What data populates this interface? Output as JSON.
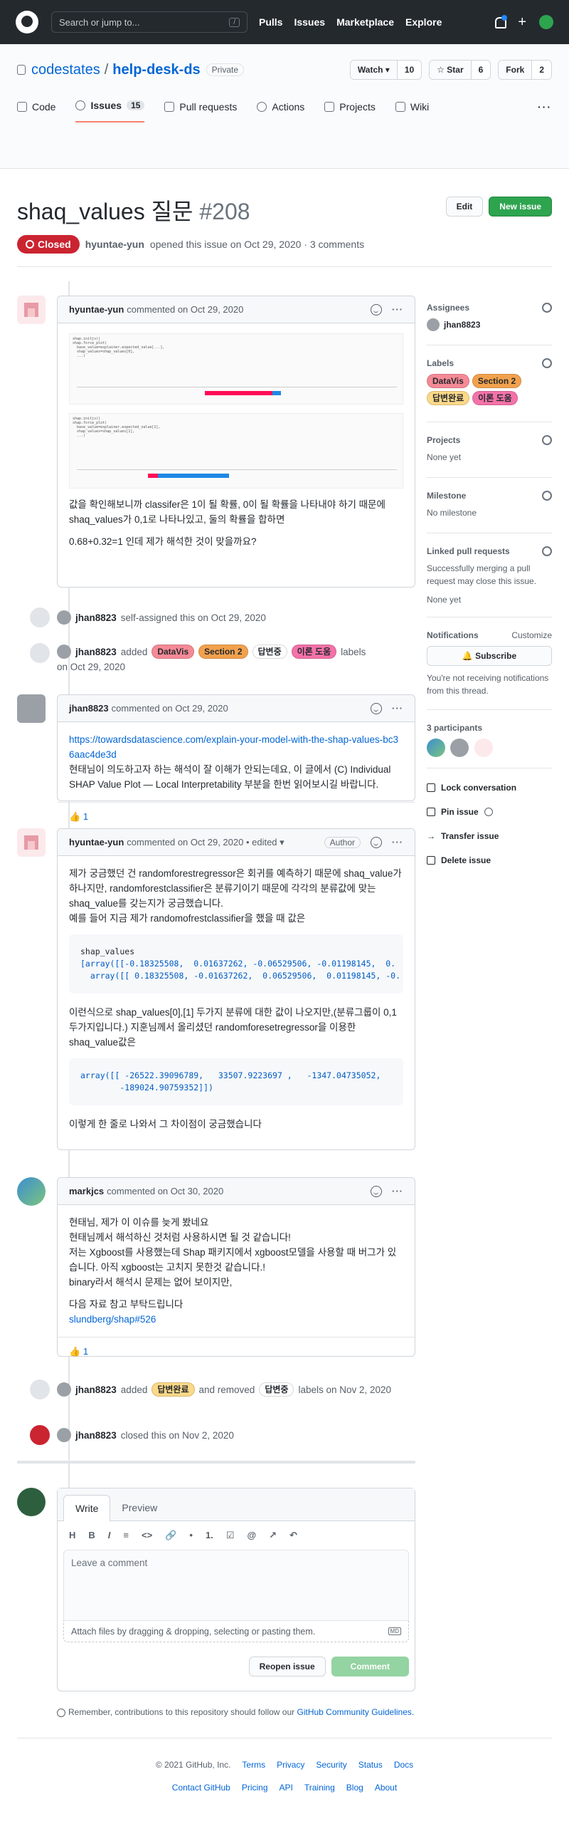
{
  "header": {
    "search_placeholder": "Search or jump to...",
    "slash": "/",
    "nav": [
      "Pulls",
      "Issues",
      "Marketplace",
      "Explore"
    ],
    "plus": "+"
  },
  "repo": {
    "owner": "codestates",
    "sep": "/",
    "name": "help-desk-ds",
    "visibility": "Private",
    "watch_label": "Watch",
    "watch_count": "10",
    "star_label": "Star",
    "star_count": "6",
    "fork_label": "Fork",
    "fork_count": "2",
    "tabs": [
      {
        "label": "Code"
      },
      {
        "label": "Issues",
        "count": "15"
      },
      {
        "label": "Pull requests"
      },
      {
        "label": "Actions"
      },
      {
        "label": "Projects"
      },
      {
        "label": "Wiki"
      }
    ],
    "more": "···"
  },
  "issue": {
    "title": "shaq_values 질문",
    "number": "#208",
    "edit": "Edit",
    "new_issue": "New issue",
    "state": "Closed",
    "author": "hyuntae-yun",
    "meta": "opened this issue on Oct 29, 2020 · 3 comments"
  },
  "comments": [
    {
      "author": "hyuntae-yun",
      "meta": "commented on Oct 29, 2020",
      "body": [
        "값을 확인해보니까 classifer은 1이 될 확률, 0이 될 확률을 나타내야 하기 때문에 shaq_values가 0,1로 나타나있고, 둘의 확률을 합하면",
        "0.68+0.32=1 인데 제가 해석한 것이 맞을까요?"
      ],
      "plot_code_1": "shap.initjs()\nshap.force_plot(\n  base_value=explainer.expected_value[...],\n  shap_values=shap_values[0],\n  ...)",
      "plot_code_2": "shap.initjs()\nshap.force_plot(\n  base_value=explainer.expected_value[1],\n  shap_values=shap_values[1],\n  ...)"
    },
    {
      "author": "jhan8823",
      "meta": "commented on Oct 29, 2020",
      "link": "https://towardsdatascience.com/explain-your-model-with-the-shap-values-bc36aac4de3d",
      "body": "현태님이 의도하고자 하는 해석이 잘 이해가 안되는데요, 이 글에서 (C) Individual SHAP Value Plot — Local Interpretability 부분을 한번 읽어보시길 바랍니다.",
      "reaction_emoji": "👍",
      "reaction_count": "1"
    },
    {
      "author": "hyuntae-yun",
      "meta": "commented on Oct 29, 2020 • edited",
      "badge": "Author",
      "body1": "제가 궁금했던 건 randomforestregressor은 회귀를 예측하기 때문에 shaq_value가 하나지만, randomforestclassifier은 분류기이기 때문에 각각의 분류값에 맞는 shaq_value를 갖는지가 궁금했습니다.",
      "body2": "예를 들어 지금 제가 randomofrestclassifier을 했을 때 값은",
      "code1_line1": "shap_values",
      "code1_line2": "[array([[-0.18325508,  0.01637262, -0.06529506, -0.01198145,  0.",
      "code1_line3": "  array([[ 0.18325508, -0.01637262,  0.06529506,  0.01198145, -0.",
      "body3": "이런식으로 shap_values[0],[1] 두가지 분류에 대한 값이 나오지만,(분류그룹이 0,1 두가지입니다.) 지훈님께서 올리셨던 randomforesetregressor을 이용한 shaq_value값은",
      "code2_line1": "array([[ -26522.39096789,   33507.9223697 ,   -1347.04735052,",
      "code2_line2": "        -189024.90759352]])",
      "body4": "이렇게 한 줄로 나와서 그 차이점이 궁금했습니다"
    },
    {
      "author": "markjcs",
      "meta": "commented on Oct 30, 2020",
      "body": [
        "현태님, 제가 이 이슈를 늦게 봤네요",
        "현태님께서 해석하신 것처럼 사용하시면 될 것 같습니다!",
        "저는 Xgboost를 사용했는데 Shap 패키지에서 xgboost모델을 사용할 때 버그가 있습니다. 아직 xgboost는 고치지 못한것 같습니다.!",
        "binary라서 해석시 문제는 없어 보이지만,"
      ],
      "ref_text": "다음 자료 참고 부탁드립니다",
      "ref_link": "slundberg/shap#526",
      "reaction_emoji": "👍",
      "reaction_count": "1"
    }
  ],
  "events": {
    "assign": {
      "user": "jhan8823",
      "text": "self-assigned this on Oct 29, 2020"
    },
    "labels1": {
      "user": "jhan8823",
      "added": "added",
      "suffix": "labels",
      "date": "on Oct 29, 2020"
    },
    "labels2": {
      "user": "jhan8823",
      "added": "added",
      "removed": "and removed",
      "suffix": "labels on Nov 2, 2020"
    },
    "closed": {
      "user": "jhan8823",
      "text": "closed this on Nov 2, 2020"
    }
  },
  "labels": {
    "datavis": "DataVis",
    "sec2": "Section 2",
    "done": "답변완료",
    "reply": "답변중",
    "theory": "이론 도움"
  },
  "sidebar": {
    "assignees_title": "Assignees",
    "assignee": "jhan8823",
    "labels_title": "Labels",
    "projects_title": "Projects",
    "projects_value": "None yet",
    "milestone_title": "Milestone",
    "milestone_value": "No milestone",
    "linked_title": "Linked pull requests",
    "linked_desc": "Successfully merging a pull request may close this issue.",
    "linked_value": "None yet",
    "notif_title": "Notifications",
    "customize": "Customize",
    "subscribe": "Subscribe",
    "notif_desc": "You're not receiving notifications from this thread.",
    "participants_title": "3 participants",
    "lock": "Lock conversation",
    "pin": "Pin issue",
    "transfer": "Transfer issue",
    "delete": "Delete issue"
  },
  "editor": {
    "write": "Write",
    "preview": "Preview",
    "tools": [
      "H",
      "B",
      "I",
      "≡",
      "<>",
      "🔗",
      "•",
      "1.",
      "☑",
      "@",
      "↗",
      "↶"
    ],
    "placeholder": "Leave a comment",
    "attach": "Attach files by dragging & dropping, selecting or pasting them.",
    "md": "MD",
    "reopen": "Reopen issue",
    "comment": "Comment",
    "remember": "Remember, contributions to this repository should follow our",
    "guidelines": "GitHub Community Guidelines."
  },
  "footer": {
    "row1": [
      "© 2021 GitHub, Inc.",
      "Terms",
      "Privacy",
      "Security",
      "Status",
      "Docs"
    ],
    "row2": [
      "Contact GitHub",
      "Pricing",
      "API",
      "Training",
      "Blog",
      "About"
    ]
  }
}
